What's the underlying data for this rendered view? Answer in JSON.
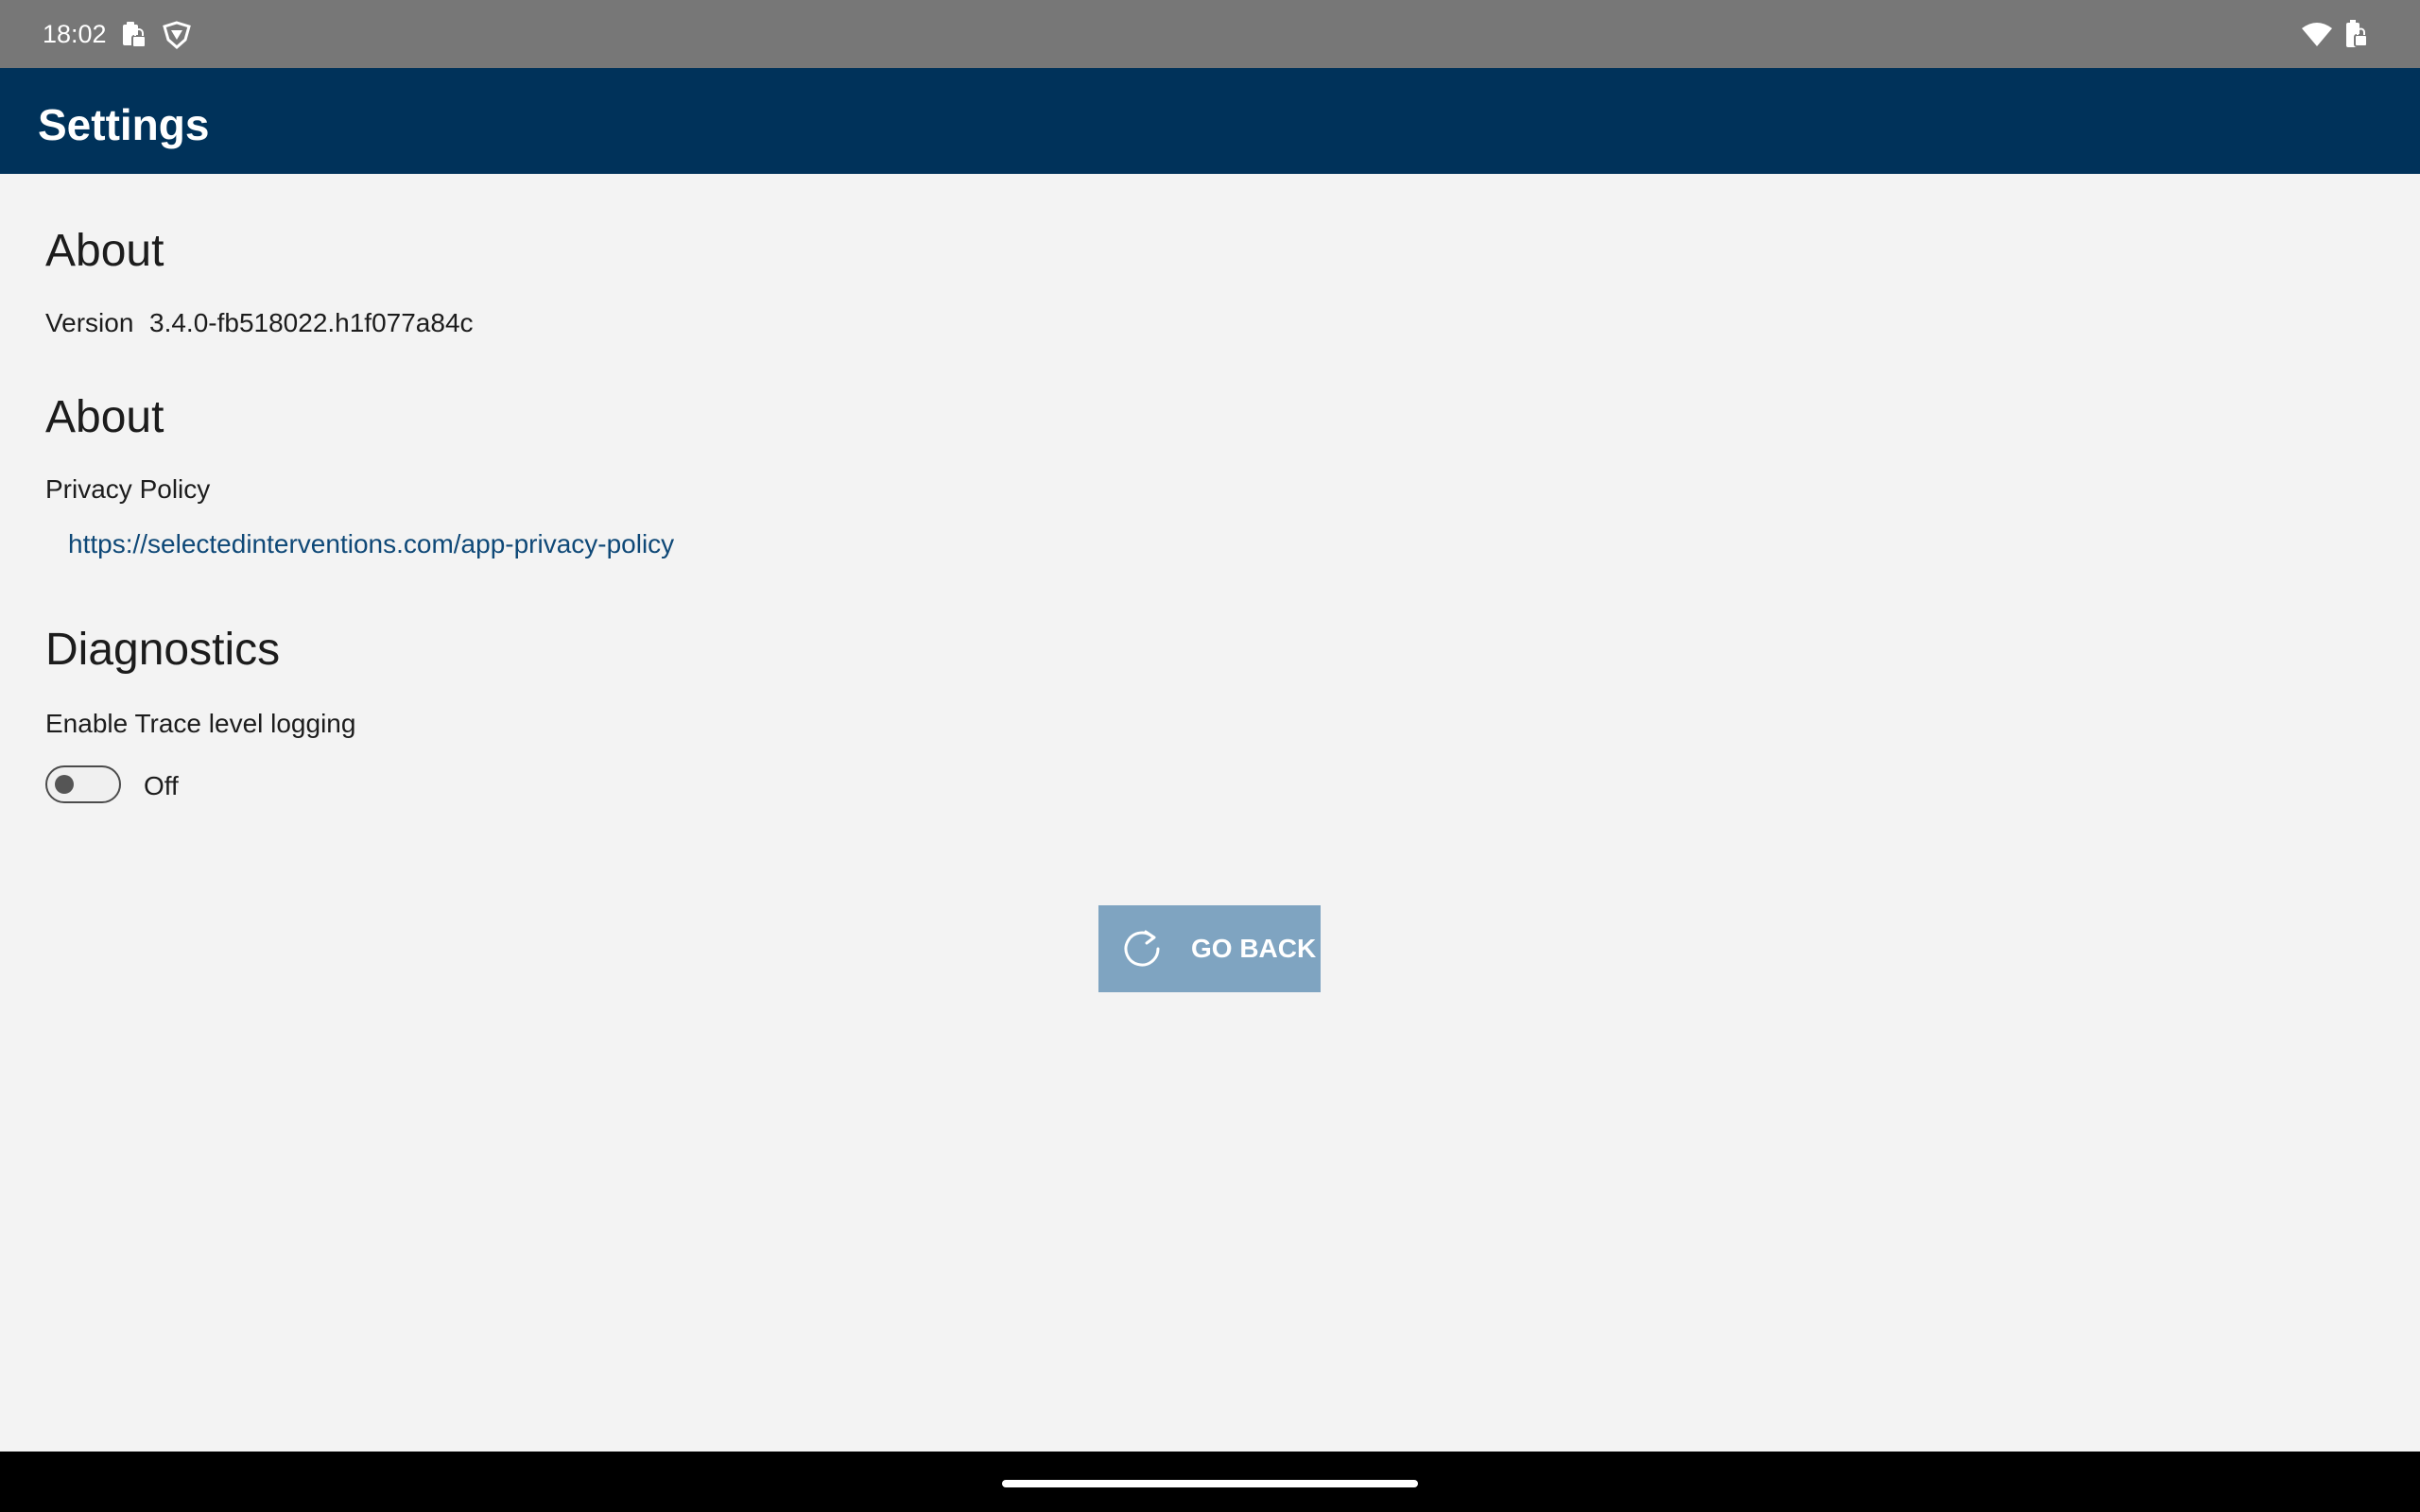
{
  "status_bar": {
    "time": "18:02",
    "left_icons": [
      "clipboard-lock-icon",
      "shield-triangle-icon"
    ],
    "right_icons": [
      "wifi-icon",
      "battery-icon"
    ]
  },
  "app_bar": {
    "title": "Settings",
    "background_color": "#00325a"
  },
  "sections": {
    "about_version": {
      "heading": "About",
      "version_label": "Version",
      "version_value": "3.4.0-fb518022.h1f077a84c"
    },
    "about_privacy": {
      "heading": "About",
      "privacy_label": "Privacy Policy",
      "privacy_link": "https://selectedinterventions.com/app-privacy-policy"
    },
    "diagnostics": {
      "heading": "Diagnostics",
      "trace_label": "Enable Trace level logging",
      "toggle_state": "Off"
    }
  },
  "go_back_button": {
    "label": "GO BACK",
    "icon": "refresh-icon",
    "color": "#7fa4c1"
  }
}
